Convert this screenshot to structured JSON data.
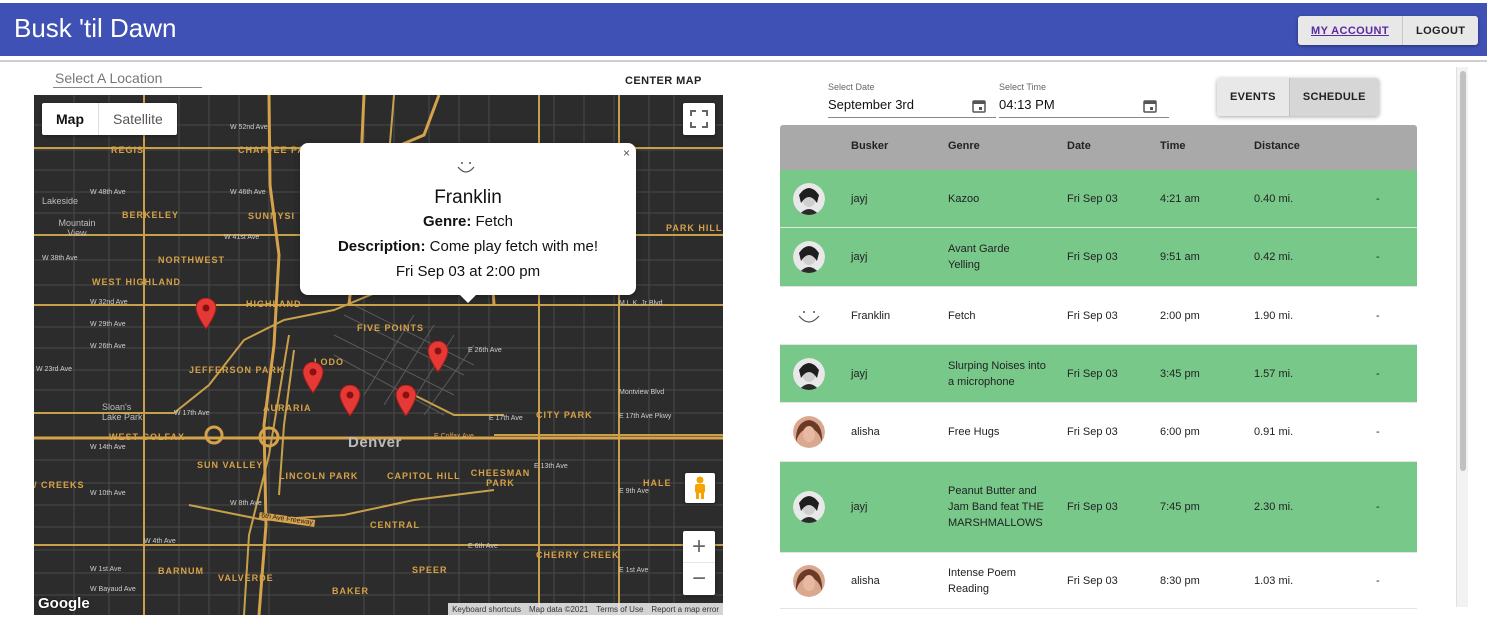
{
  "header": {
    "title": "Busk 'til Dawn",
    "my_account": "MY ACCOUNT",
    "logout": "LOGOUT",
    "bar_color": "#3f51b5"
  },
  "map_panel": {
    "location_placeholder": "Select A Location",
    "center_map": "CENTER MAP",
    "map_type": {
      "map": "Map",
      "satellite": "Satellite"
    },
    "logo": "Google",
    "attribution": [
      "Keyboard shortcuts",
      "Map data ©2021",
      "Terms of Use",
      "Report a map error"
    ],
    "labels": {
      "regis": "REGIS",
      "chaffee_park": "CHAFFEE PARK",
      "lakeside": "Lakeside",
      "berkeley": "BERKELEY",
      "sunnyside": "SUNNYSI",
      "mountain_view": "Mountain View",
      "northwest": "NORTHWEST",
      "west_highland": "WEST HIGHLAND",
      "highland": "HIGHLAND",
      "park_hill": "PARK HILL",
      "five_points": "FIVE POINTS",
      "lodo": "LODO",
      "jefferson_park": "JEFFERSON PARK",
      "auraria": "AURARIA",
      "sloans_lake": "Sloan's Lake Park",
      "west_colfax": "WEST COLFAX",
      "denver": "Denver",
      "city_park": "CITY PARK",
      "sun_valley": "SUN VALLEY",
      "lincoln_park": "LINCOLN PARK",
      "capitol_hill": "CAPITOL HILL",
      "cheesman_park": "CHEESMAN PARK",
      "hale": "HALE",
      "creeks": "/ CREEKS",
      "central": "CENTRAL",
      "cherry_creek": "CHERRY CREEK",
      "barnum": "BARNUM",
      "valverde": "VALVERDE",
      "speer": "SPEER",
      "baker": "BAKER",
      "colfax_ave": "E Colfax Ave",
      "w_52nd": "W 52nd Ave",
      "w_48th": "W 48th Ave",
      "w_46th": "W 46th Ave",
      "w_41st": "W 41st Ave",
      "w_38th": "W 38th Ave",
      "w_32nd": "W 32nd Ave",
      "w_29th": "W 29th Ave",
      "w_26th": "W 26th Ave",
      "w_23rd": "W 23rd Ave",
      "w_17th": "W 17th Ave",
      "w_14th": "W 14th Ave",
      "w_10th": "W 10th Ave",
      "w_8th": "W 8th Ave",
      "w_4th": "W 4th Ave",
      "w_1st": "W 1st Ave",
      "w_bayaud": "W Bayaud Ave",
      "e_26th": "E 26th Ave",
      "e_17th": "E 17th Ave",
      "e_9th": "E 9th Ave",
      "e_6th": "E 6th Ave",
      "e_1st": "E 1st Ave",
      "e_13th": "E 13th Ave",
      "mlk": "M.L.K. Jr Blvd",
      "sixth_ave_fwy": "6th Ave Freeway",
      "montview": "Montview Blvd",
      "e_17th_pkwy": "E 17th Ave Pkwy"
    },
    "popup": {
      "name": "Franklin",
      "genre_label": "Genre:",
      "genre": "Fetch",
      "description_label": "Description:",
      "description": "Come play fetch with me!",
      "when": "Fri Sep 03 at 2:00 pm",
      "close": "×"
    }
  },
  "schedule_panel": {
    "date_label": "Select Date",
    "date_value": "September 3rd",
    "time_label": "Select Time",
    "time_value": "04:13 PM",
    "tabs": {
      "events": "EVENTS",
      "schedule": "SCHEDULE"
    },
    "columns": [
      "Busker",
      "Genre",
      "Date",
      "Time",
      "Distance"
    ],
    "highlight_color": "#78c88a",
    "rows": [
      {
        "busker": "jayj",
        "genre": "Kazoo",
        "date": "Fri Sep 03",
        "time": "4:21 am",
        "distance": "0.40 mi.",
        "extra": "-",
        "highlight": true,
        "avatar": "photo-man"
      },
      {
        "busker": "jayj",
        "genre": "Avant Garde Yelling",
        "date": "Fri Sep 03",
        "time": "9:51 am",
        "distance": "0.42 mi.",
        "extra": "-",
        "highlight": true,
        "avatar": "photo-man"
      },
      {
        "busker": "Franklin",
        "genre": "Fetch",
        "date": "Fri Sep 03",
        "time": "2:00 pm",
        "distance": "1.90 mi.",
        "extra": "-",
        "highlight": false,
        "avatar": "smiley"
      },
      {
        "busker": "jayj",
        "genre": "Slurping Noises into a microphone",
        "date": "Fri Sep 03",
        "time": "3:45 pm",
        "distance": "1.57 mi.",
        "extra": "-",
        "highlight": true,
        "avatar": "photo-man"
      },
      {
        "busker": "alisha",
        "genre": "Free Hugs",
        "date": "Fri Sep 03",
        "time": "6:00 pm",
        "distance": "0.91 mi.",
        "extra": "-",
        "highlight": false,
        "avatar": "photo-woman"
      },
      {
        "busker": "jayj",
        "genre": "Peanut Butter and Jam Band feat THE MARSHMALLOWS",
        "date": "Fri Sep 03",
        "time": "7:45 pm",
        "distance": "2.30 mi.",
        "extra": "-",
        "highlight": true,
        "avatar": "photo-man"
      },
      {
        "busker": "alisha",
        "genre": "Intense Poem Reading",
        "date": "Fri Sep 03",
        "time": "8:30 pm",
        "distance": "1.03 mi.",
        "extra": "-",
        "highlight": false,
        "avatar": "photo-woman"
      }
    ]
  }
}
